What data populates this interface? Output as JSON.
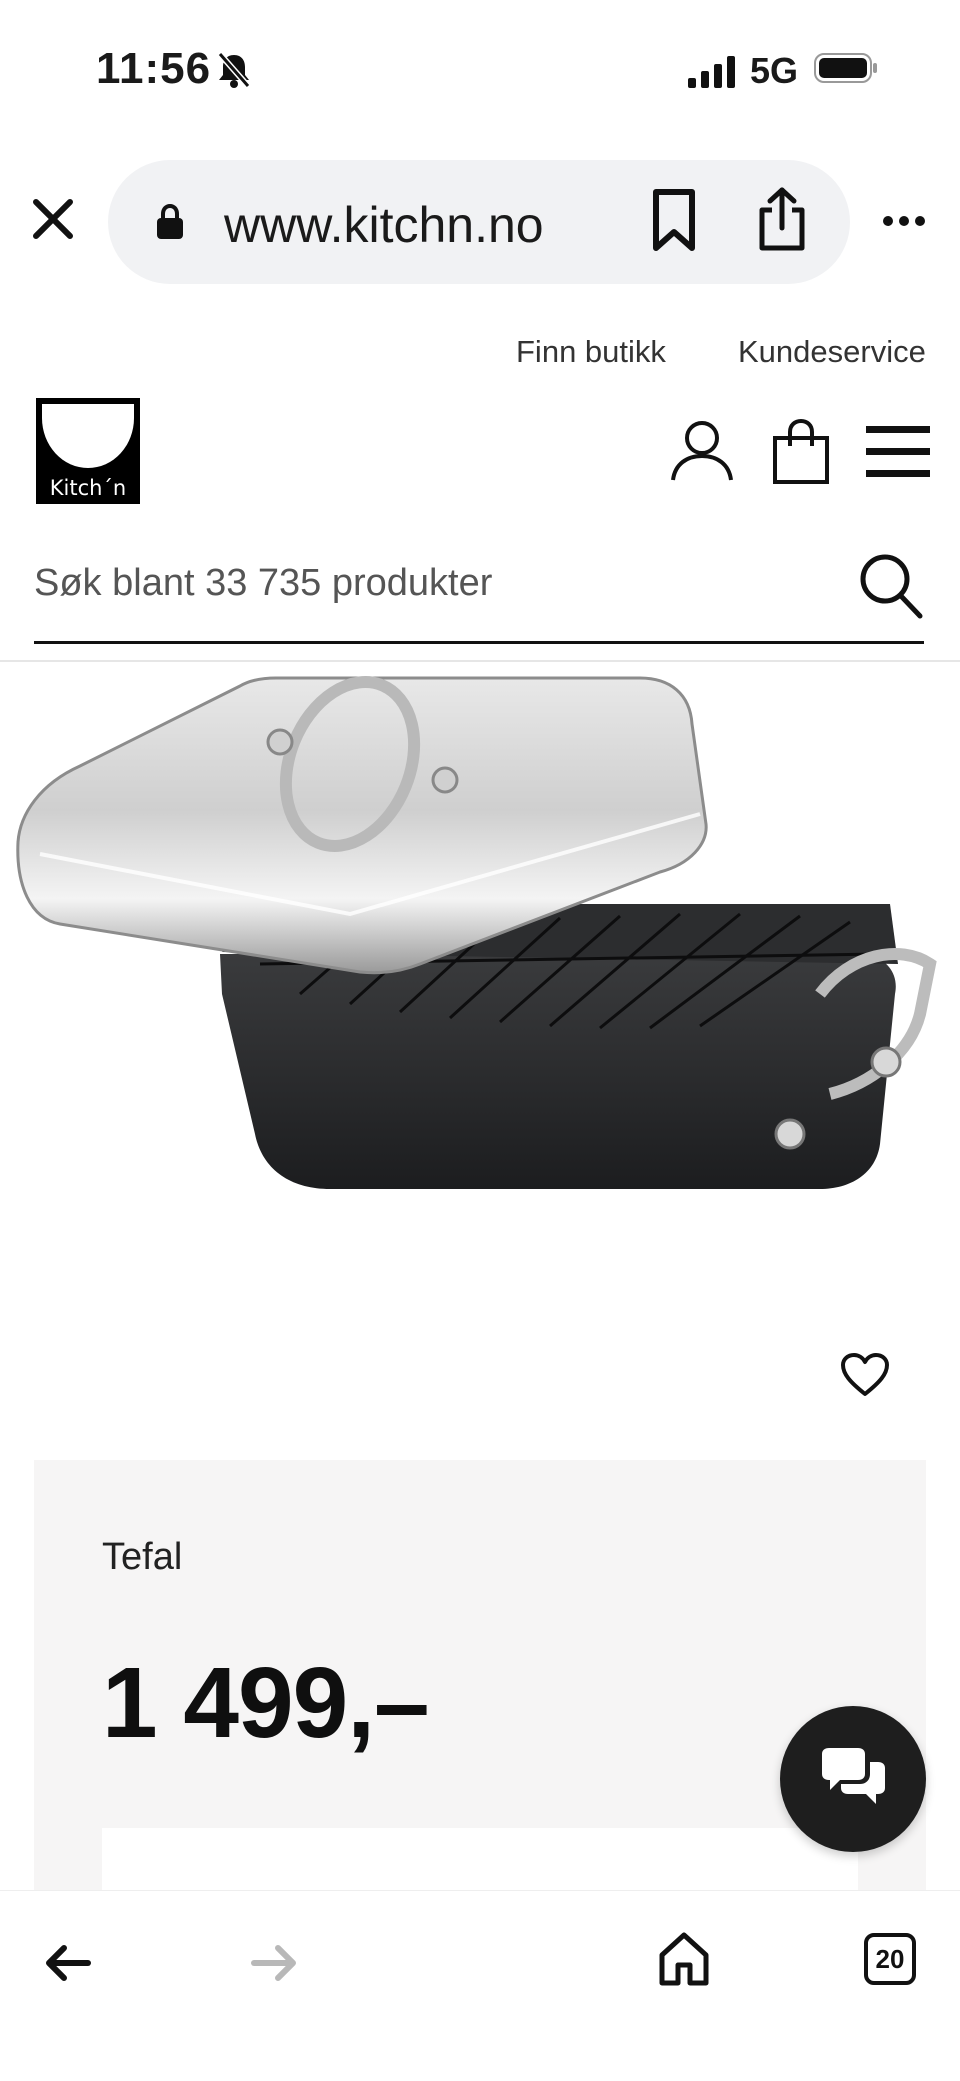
{
  "status_bar": {
    "time": "11:56",
    "network": "5G"
  },
  "browser": {
    "url": "www.kitchn.no"
  },
  "top_links": {
    "find_store": "Finn butikk",
    "customer_service": "Kundeservice"
  },
  "logo": {
    "text": "Kitch´n"
  },
  "search": {
    "placeholder": "Søk blant 33 735 produkter"
  },
  "product": {
    "brand": "Tefal",
    "price": "1 499,–"
  },
  "bottom_nav": {
    "tab_count": "20"
  },
  "icons": {
    "status": [
      "bell-slash-icon",
      "signal-icon",
      "battery-icon"
    ],
    "browser": [
      "close-icon",
      "lock-icon",
      "bookmark-icon",
      "share-icon",
      "more-icon"
    ],
    "header": [
      "user-icon",
      "shopping-bag-icon",
      "hamburger-menu-icon",
      "search-icon"
    ],
    "product": [
      "heart-icon",
      "chat-icon"
    ],
    "bottom_nav": [
      "arrow-left-icon",
      "arrow-right-icon",
      "home-icon",
      "tabs-icon"
    ]
  },
  "colors": {
    "accent": "#1e1e1e",
    "card_background": "#f6f5f5",
    "url_bar": "#f1f2f4"
  }
}
